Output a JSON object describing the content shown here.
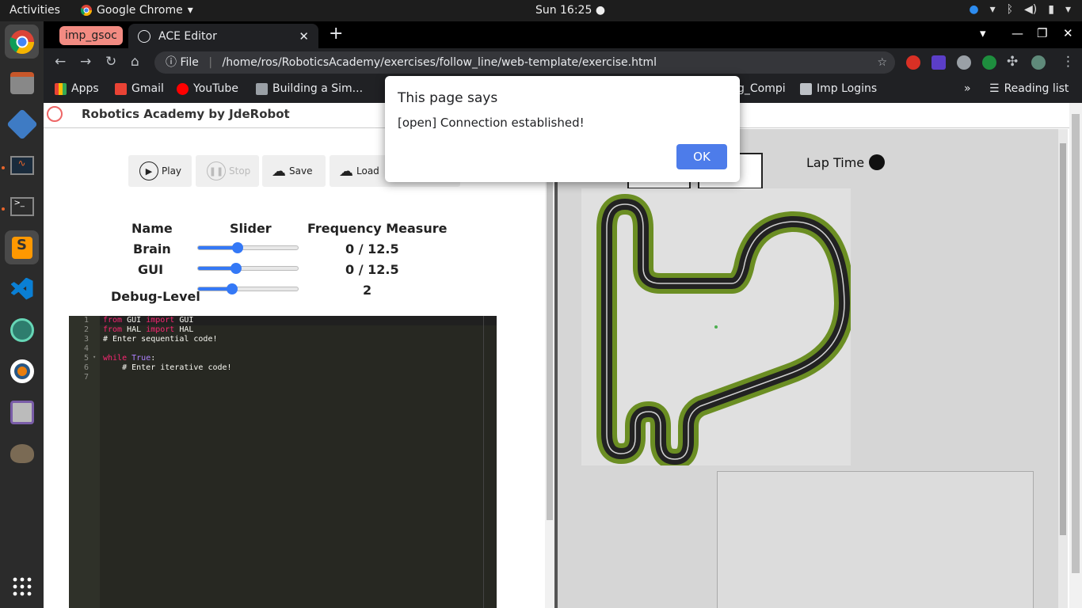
{
  "topbar": {
    "activities": "Activities",
    "app_name": "Google Chrome",
    "clock": "Sun 16:25 ●"
  },
  "dock": {
    "items": [
      "chrome-icon",
      "files-icon",
      "virtualbox-icon",
      "system-monitor-icon",
      "terminal-icon",
      "sublime-icon",
      "vscode-icon",
      "atom-icon",
      "blender-icon",
      "cheese-icon",
      "gimp-icon",
      "app-grid-icon"
    ]
  },
  "chrome": {
    "tab_group": "imp_gsoc",
    "tab_title": "ACE Editor",
    "tab_close": "✕",
    "new_tab": "+",
    "url_scheme": "File",
    "url": "/home/ros/RoboticsAcademy/exercises/follow_line/web-template/exercise.html",
    "bookmarks": {
      "apps": "Apps",
      "gmail": "Gmail",
      "youtube": "YouTube",
      "building": "Building a Sim...",
      "partial": "g_Compi",
      "imp_logins": "Imp Logins",
      "more": "»",
      "reading_list": "Reading list"
    }
  },
  "page": {
    "brand": "Robotics Academy by JdeRobot",
    "buttons": {
      "play": "Play",
      "stop": "Stop",
      "save": "Save",
      "load": "Load"
    },
    "table": {
      "headers": [
        "Name",
        "Slider",
        "Frequency Measure"
      ],
      "rows": [
        {
          "name": "Brain",
          "value": "0 / 12.5",
          "slider": 0.4
        },
        {
          "name": "GUI",
          "value": "0 / 12.5",
          "slider": 0.38
        },
        {
          "name": "Debug-Level",
          "value": "2",
          "slider": 0.34
        }
      ]
    },
    "editor": {
      "line_numbers": [
        "1",
        "2",
        "3",
        "4",
        "5",
        "6",
        "7"
      ]
    },
    "lap_time": "Lap Time"
  },
  "alert": {
    "title": "This page says",
    "message": "[open] Connection established!",
    "ok": "OK"
  },
  "colors": {
    "accent": "#3478f6",
    "ok_button": "#4d7cea",
    "tab_group": "#f28b82",
    "editor_bg": "#272822"
  }
}
